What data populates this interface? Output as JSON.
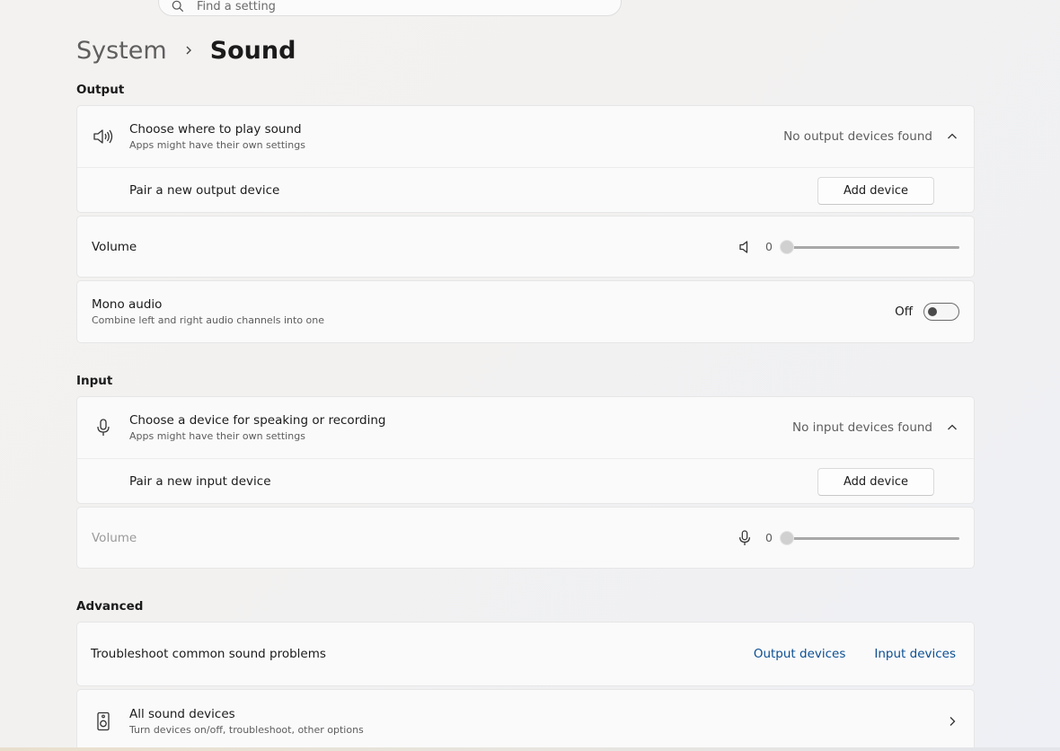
{
  "search": {
    "placeholder": "Find a setting"
  },
  "breadcrumb": {
    "parent": "System",
    "current": "Sound"
  },
  "output": {
    "section_title": "Output",
    "choose": {
      "title": "Choose where to play sound",
      "subtitle": "Apps might have their own settings",
      "status": "No output devices found"
    },
    "pair": {
      "label": "Pair a new output device",
      "button": "Add device"
    },
    "volume": {
      "label": "Volume",
      "value": "0"
    },
    "mono": {
      "title": "Mono audio",
      "subtitle": "Combine left and right audio channels into one",
      "state": "Off"
    }
  },
  "input": {
    "section_title": "Input",
    "choose": {
      "title": "Choose a device for speaking or recording",
      "subtitle": "Apps might have their own settings",
      "status": "No input devices found"
    },
    "pair": {
      "label": "Pair a new input device",
      "button": "Add device"
    },
    "volume": {
      "label": "Volume",
      "value": "0"
    }
  },
  "advanced": {
    "section_title": "Advanced",
    "troubleshoot": {
      "label": "Troubleshoot common sound problems",
      "link_output": "Output devices",
      "link_input": "Input devices"
    },
    "all_devices": {
      "title": "All sound devices",
      "subtitle": "Turn devices on/off, troubleshoot, other options"
    }
  },
  "colors": {
    "link": "#0b4f93",
    "text": "#1b1b1b",
    "secondary": "#5d5d5d"
  }
}
